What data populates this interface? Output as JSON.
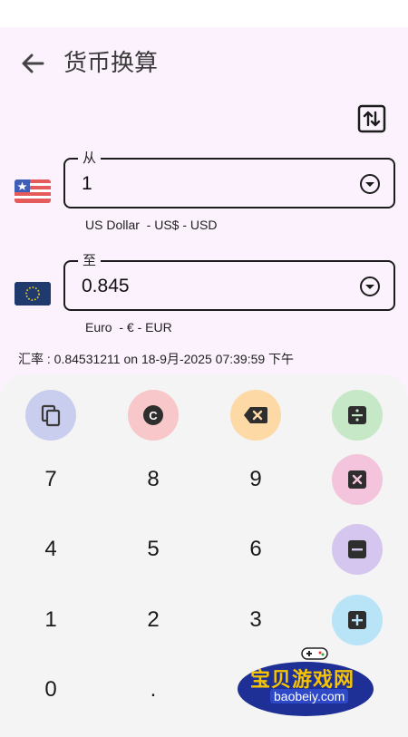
{
  "header": {
    "title": "货币换算"
  },
  "from": {
    "legend": "从",
    "value": "1",
    "currency_label": "US Dollar  - US$ - USD"
  },
  "to": {
    "legend": "至",
    "value": "0.845",
    "currency_label": "Euro  - € - EUR"
  },
  "rate_text": "汇率 : 0.84531211 on 18-9月-2025 07:39:59 下午",
  "keypad": {
    "digits": [
      "7",
      "8",
      "9",
      "4",
      "5",
      "6",
      "1",
      "2",
      "3",
      "0",
      "."
    ],
    "actions": {
      "copy": "copy-icon",
      "clear": "C",
      "backspace": "backspace-icon",
      "divide": "divide-icon",
      "multiply": "multiply-icon",
      "subtract": "minus-icon",
      "add": "plus-icon"
    },
    "colors": {
      "copy": "#c9cdee",
      "clear": "#f7c7c9",
      "backspace": "#fdd9a6",
      "divide": "#c6e8c6",
      "multiply": "#f3c4dc",
      "subtract": "#d4c6ee",
      "add": "#b9e3f7"
    }
  },
  "watermark": {
    "text": "宝贝游戏网",
    "url": "baobeiy.com"
  }
}
